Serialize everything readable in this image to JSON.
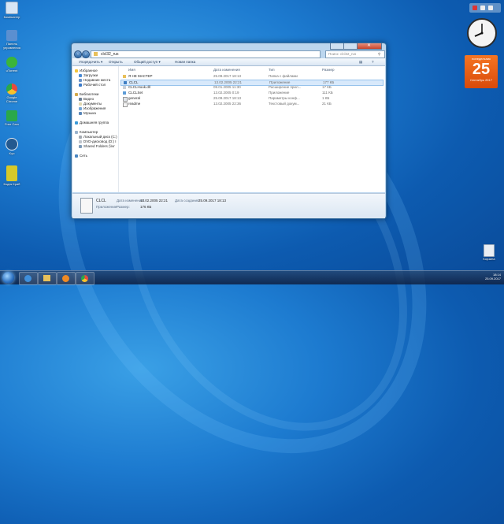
{
  "desktop": {
    "icons": [
      {
        "label": "Компьютер",
        "icon": "computer-icon",
        "color": "#d7e6f5"
      },
      {
        "label": "Панель управления",
        "icon": "control-panel-icon",
        "color": "#5b8fd0"
      },
      {
        "label": "uTorrent",
        "icon": "utorrent-icon",
        "color": "#3bb53b"
      },
      {
        "label": "Google Chrome",
        "icon": "chrome-icon",
        "color": "#e84b3c"
      },
      {
        "label": "Free Cam",
        "icon": "freecam-icon",
        "color": "#2aa84a"
      },
      {
        "label": "Kyo",
        "icon": "kyo-icon",
        "color": "#24598f"
      },
      {
        "label": "Кодек Краб",
        "icon": "codec-icon",
        "color": "#d6c92a"
      }
    ],
    "recycle_label": "Корзина"
  },
  "gadgets": {
    "calendar": {
      "dow": "понедельник",
      "day": "25",
      "month": "Сентябрь 2017"
    }
  },
  "window": {
    "address": "clcl32_rus",
    "search_placeholder": "Поиск: clcl32_rus",
    "toolbar": [
      "Упорядочить ▾",
      "Открыть",
      "Общий доступ ▾",
      "Новая папка"
    ],
    "nav": {
      "favorites": "Избранное",
      "downloads": "Загрузки",
      "recent": "Недавние места",
      "desktop": "Рабочий стол",
      "libraries": "Библиотеки",
      "video": "Видео",
      "documents": "Документы",
      "images": "Изображения",
      "music": "Музыка",
      "homegroup": "Домашняя группа",
      "computer": "Компьютер",
      "local_disk": "Локальный диск (C:)",
      "dvd": "DVD-дисковод (D:) I",
      "shared": "Shared Folders (\\\\vr",
      "network": "Сеть"
    },
    "columns": [
      "Имя",
      "Дата изменения",
      "Тип",
      "Размер"
    ],
    "files": [
      {
        "name": "Я НЕ МАСТЕР",
        "date": "25.09.2017 18:13",
        "type": "Папка с файлами",
        "size": "",
        "kind": "folder"
      },
      {
        "name": "CLCL",
        "date": "13.02.2005 22:21",
        "type": "Приложение",
        "size": "177 КБ",
        "kind": "app"
      },
      {
        "name": "CLCLHook.dll",
        "date": "09.01.2005 11:30",
        "type": "Расширение прил...",
        "size": "17 КБ",
        "kind": "dll"
      },
      {
        "name": "CLCLSet",
        "date": "13.02.2005 0:19",
        "type": "Приложение",
        "size": "111 КБ",
        "kind": "app"
      },
      {
        "name": "general",
        "date": "25.09.2017 18:13",
        "type": "Параметры конф...",
        "size": "1 КБ",
        "kind": "cfg"
      },
      {
        "name": "readme",
        "date": "13.02.2005 22:36",
        "type": "Текстовый докум...",
        "size": "21 КБ",
        "kind": "txt"
      }
    ],
    "details": {
      "name": "CLCL",
      "type": "Приложение",
      "modified_label": "Дата изменения:",
      "modified": "13.02.2005 22:21",
      "size_label": "Размер:",
      "size": "176 КБ",
      "created_label": "Дата создания:",
      "created": "25.09.2017 18:13"
    }
  },
  "taskbar": {
    "time": "18:14",
    "date": "25.09.2017"
  }
}
